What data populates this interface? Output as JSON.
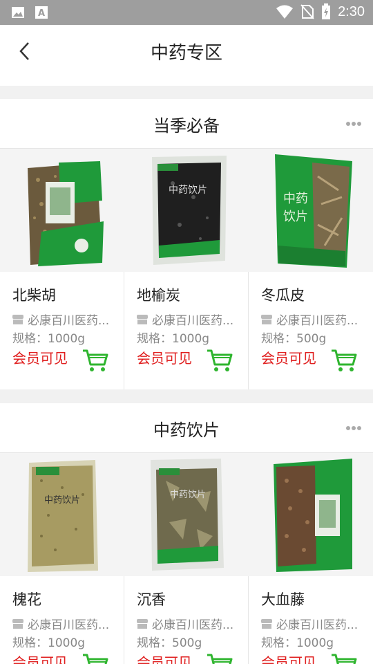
{
  "status_bar": {
    "time": "2:30",
    "left_icons": [
      "image-icon",
      "a-icon"
    ],
    "right_icons": [
      "wifi-icon",
      "no-sim-icon",
      "battery-icon"
    ]
  },
  "header": {
    "title": "中药专区",
    "back_icon": "back-arrow-icon"
  },
  "sections": [
    {
      "title": "当季必备",
      "products": [
        {
          "name": "北柴胡",
          "shop": "必康百川医药...",
          "spec": "规格：1000g",
          "price": "会员可见"
        },
        {
          "name": "地榆炭",
          "shop": "必康百川医药...",
          "spec": "规格：1000g",
          "price": "会员可见"
        },
        {
          "name": "冬瓜皮",
          "shop": "必康百川医药...",
          "spec": "规格：500g",
          "price": "会员可见"
        }
      ]
    },
    {
      "title": "中药饮片",
      "products": [
        {
          "name": "槐花",
          "shop": "必康百川医药...",
          "spec": "规格：1000g",
          "price": "会员可见"
        },
        {
          "name": "沉香",
          "shop": "必康百川医药...",
          "spec": "规格：500g",
          "price": "会员可见"
        },
        {
          "name": "大血藤",
          "shop": "必康百川医药...",
          "spec": "规格：1000g",
          "price": "会员可见"
        }
      ]
    }
  ],
  "colors": {
    "price": "#e02020",
    "cart": "#2fb52f",
    "bag_green": "#1f9a3a"
  }
}
